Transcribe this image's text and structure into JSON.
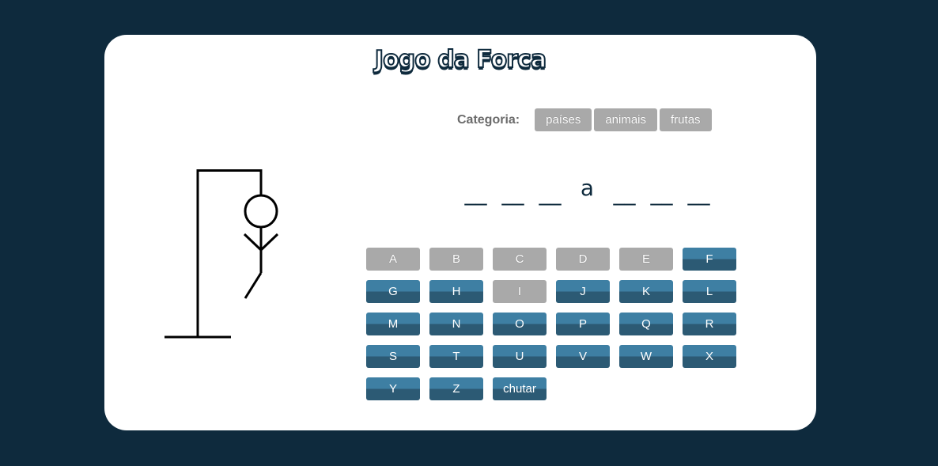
{
  "title": "Jogo da Forca",
  "category": {
    "label": "Categoria:",
    "options": [
      "países",
      "animais",
      "frutas"
    ]
  },
  "word": {
    "slots": [
      "__",
      "__",
      "__",
      "a",
      "__",
      "__",
      "__"
    ]
  },
  "keyboard": {
    "keys": [
      {
        "label": "A",
        "used": true
      },
      {
        "label": "B",
        "used": true
      },
      {
        "label": "C",
        "used": true
      },
      {
        "label": "D",
        "used": true
      },
      {
        "label": "E",
        "used": true
      },
      {
        "label": "F",
        "used": false
      },
      {
        "label": "G",
        "used": false
      },
      {
        "label": "H",
        "used": false
      },
      {
        "label": "I",
        "used": true
      },
      {
        "label": "J",
        "used": false
      },
      {
        "label": "K",
        "used": false
      },
      {
        "label": "L",
        "used": false
      },
      {
        "label": "M",
        "used": false
      },
      {
        "label": "N",
        "used": false
      },
      {
        "label": "O",
        "used": false
      },
      {
        "label": "P",
        "used": false
      },
      {
        "label": "Q",
        "used": false
      },
      {
        "label": "R",
        "used": false
      },
      {
        "label": "S",
        "used": false
      },
      {
        "label": "T",
        "used": false
      },
      {
        "label": "U",
        "used": false
      },
      {
        "label": "V",
        "used": false
      },
      {
        "label": "W",
        "used": false
      },
      {
        "label": "X",
        "used": false
      },
      {
        "label": "Y",
        "used": false
      },
      {
        "label": "Z",
        "used": false
      },
      {
        "label": "chutar",
        "used": false
      }
    ]
  },
  "colors": {
    "background": "#0e2a3d",
    "key_active": "#3e7fa3",
    "key_used": "#a9a9a9"
  }
}
